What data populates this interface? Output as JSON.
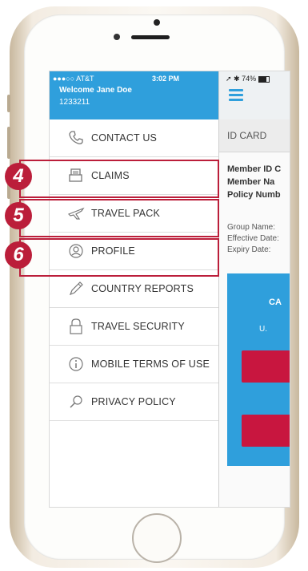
{
  "status_bar": {
    "carrier": "●●●○○ AT&T",
    "time": "3:02 PM",
    "right_status": "74%"
  },
  "header": {
    "welcome": "Welcome Jane Doe",
    "member_number": "1233211"
  },
  "menu": {
    "items": [
      {
        "label": "CONTACT US",
        "icon": "phone-icon"
      },
      {
        "label": "CLAIMS",
        "icon": "claims-icon"
      },
      {
        "label": "TRAVEL PACK",
        "icon": "airplane-icon"
      },
      {
        "label": "PROFILE",
        "icon": "profile-icon"
      },
      {
        "label": "COUNTRY REPORTS",
        "icon": "pencil-icon"
      },
      {
        "label": "TRAVEL SECURITY",
        "icon": "lock-icon"
      },
      {
        "label": "MOBILE TERMS OF USE",
        "icon": "info-icon"
      },
      {
        "label": "PRIVACY POLICY",
        "icon": "search-icon"
      }
    ]
  },
  "content": {
    "title": "ID CARD",
    "member_id_label": "Member ID C",
    "member_name_label": "Member Na",
    "policy_number_label": "Policy Numb",
    "group_name_label": "Group Name:",
    "effective_date_label": "Effective Date:",
    "expiry_date_label": "Expiry Date:",
    "card_label": "CA",
    "card_sub": "U."
  },
  "callouts": [
    "4",
    "5",
    "6"
  ],
  "colors": {
    "accent_blue": "#2f9fdc",
    "callout_red": "#bb1e3a",
    "button_red": "#c8163f"
  }
}
